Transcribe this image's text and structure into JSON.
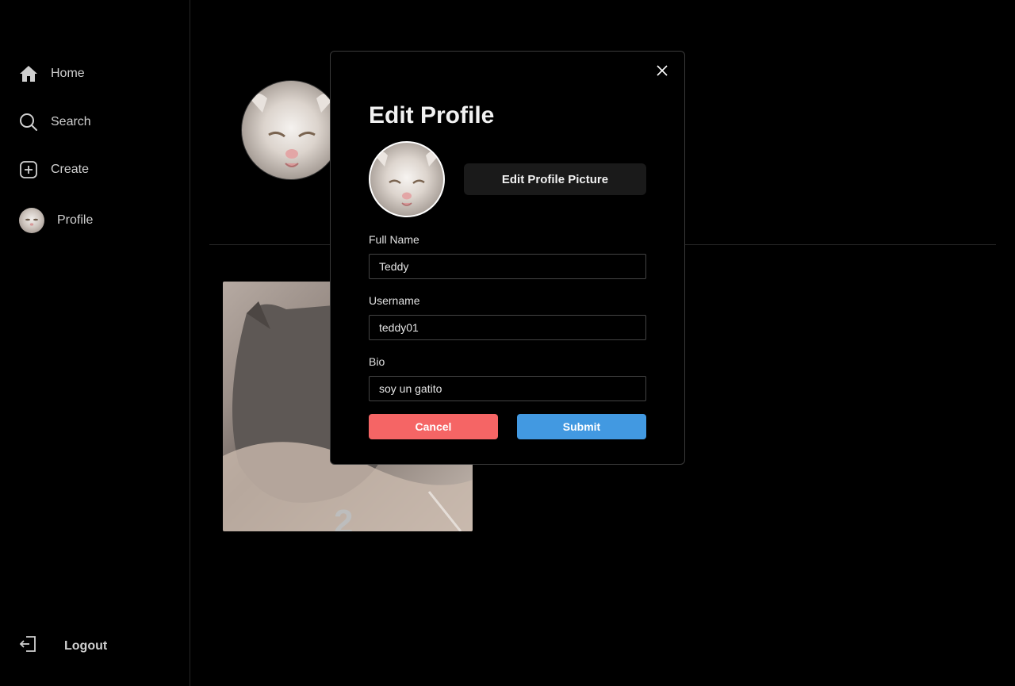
{
  "sidebar": {
    "items": [
      {
        "label": "Home",
        "icon": "home-icon"
      },
      {
        "label": "Search",
        "icon": "search-icon"
      },
      {
        "label": "Create",
        "icon": "plus-square-icon"
      },
      {
        "label": "Profile",
        "icon": "avatar"
      }
    ],
    "logout_label": "Logout"
  },
  "background": {
    "post_count_glyph": "2"
  },
  "modal": {
    "title": "Edit Profile",
    "edit_picture_label": "Edit Profile Picture",
    "fields": {
      "full_name": {
        "label": "Full Name",
        "value": "Teddy"
      },
      "username": {
        "label": "Username",
        "value": "teddy01"
      },
      "bio": {
        "label": "Bio",
        "value": "soy un gatito"
      }
    },
    "cancel_label": "Cancel",
    "submit_label": "Submit"
  },
  "colors": {
    "cancel": "#f56565",
    "submit": "#4299e1",
    "background": "#000000"
  }
}
